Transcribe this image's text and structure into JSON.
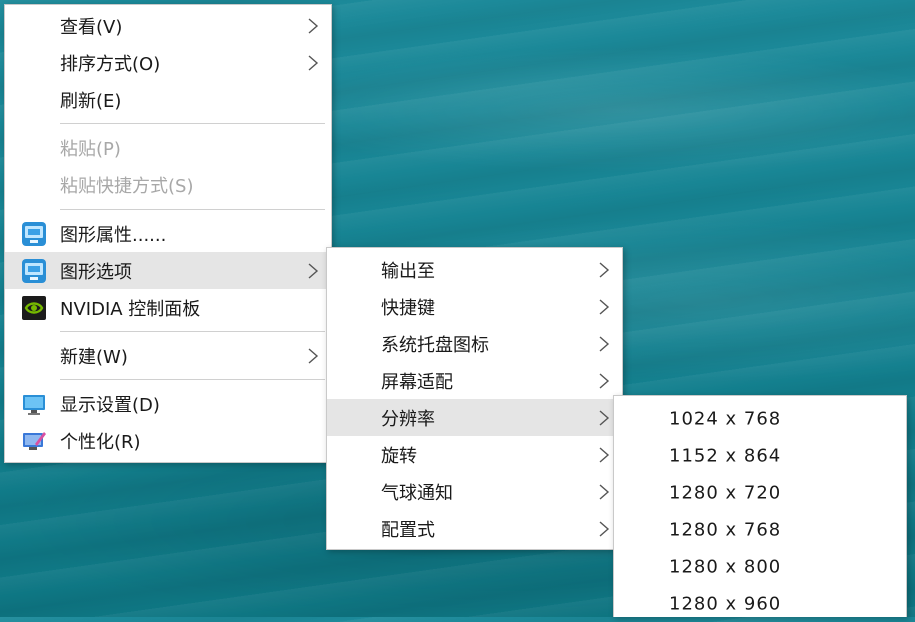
{
  "context_menu": {
    "items": [
      {
        "label": "查看(V)",
        "has_submenu": true
      },
      {
        "label": "排序方式(O)",
        "has_submenu": true
      },
      {
        "label": "刷新(E)",
        "has_submenu": false
      },
      {
        "label": "粘贴(P)",
        "disabled": true
      },
      {
        "label": "粘贴快捷方式(S)",
        "disabled": true
      },
      {
        "label": "图形属性......",
        "icon": "intel-graphics-icon"
      },
      {
        "label": "图形选项",
        "icon": "intel-graphics-icon",
        "has_submenu": true,
        "highlighted": true
      },
      {
        "label": "NVIDIA 控制面板",
        "icon": "nvidia-icon"
      },
      {
        "label": "新建(W)",
        "has_submenu": true
      },
      {
        "label": "显示设置(D)",
        "icon": "display-settings-icon"
      },
      {
        "label": "个性化(R)",
        "icon": "personalize-icon"
      }
    ]
  },
  "graphics_options_menu": {
    "items": [
      {
        "label": "输出至",
        "has_submenu": true
      },
      {
        "label": "快捷键",
        "has_submenu": true
      },
      {
        "label": "系统托盘图标",
        "has_submenu": true
      },
      {
        "label": "屏幕适配",
        "has_submenu": true
      },
      {
        "label": "分辨率",
        "has_submenu": true,
        "highlighted": true
      },
      {
        "label": "旋转",
        "has_submenu": true
      },
      {
        "label": "气球通知",
        "has_submenu": true
      },
      {
        "label": "配置式",
        "has_submenu": true
      }
    ]
  },
  "resolution_menu": {
    "items": [
      {
        "label": "1024 x 768"
      },
      {
        "label": "1152 x 864"
      },
      {
        "label": "1280 x 720"
      },
      {
        "label": "1280 x 768"
      },
      {
        "label": "1280 x 800"
      },
      {
        "label": "1280 x 960"
      }
    ]
  },
  "colors": {
    "desktop": "#178594",
    "highlight": "#e5e5e5",
    "disabled_text": "#a8a8a8"
  }
}
